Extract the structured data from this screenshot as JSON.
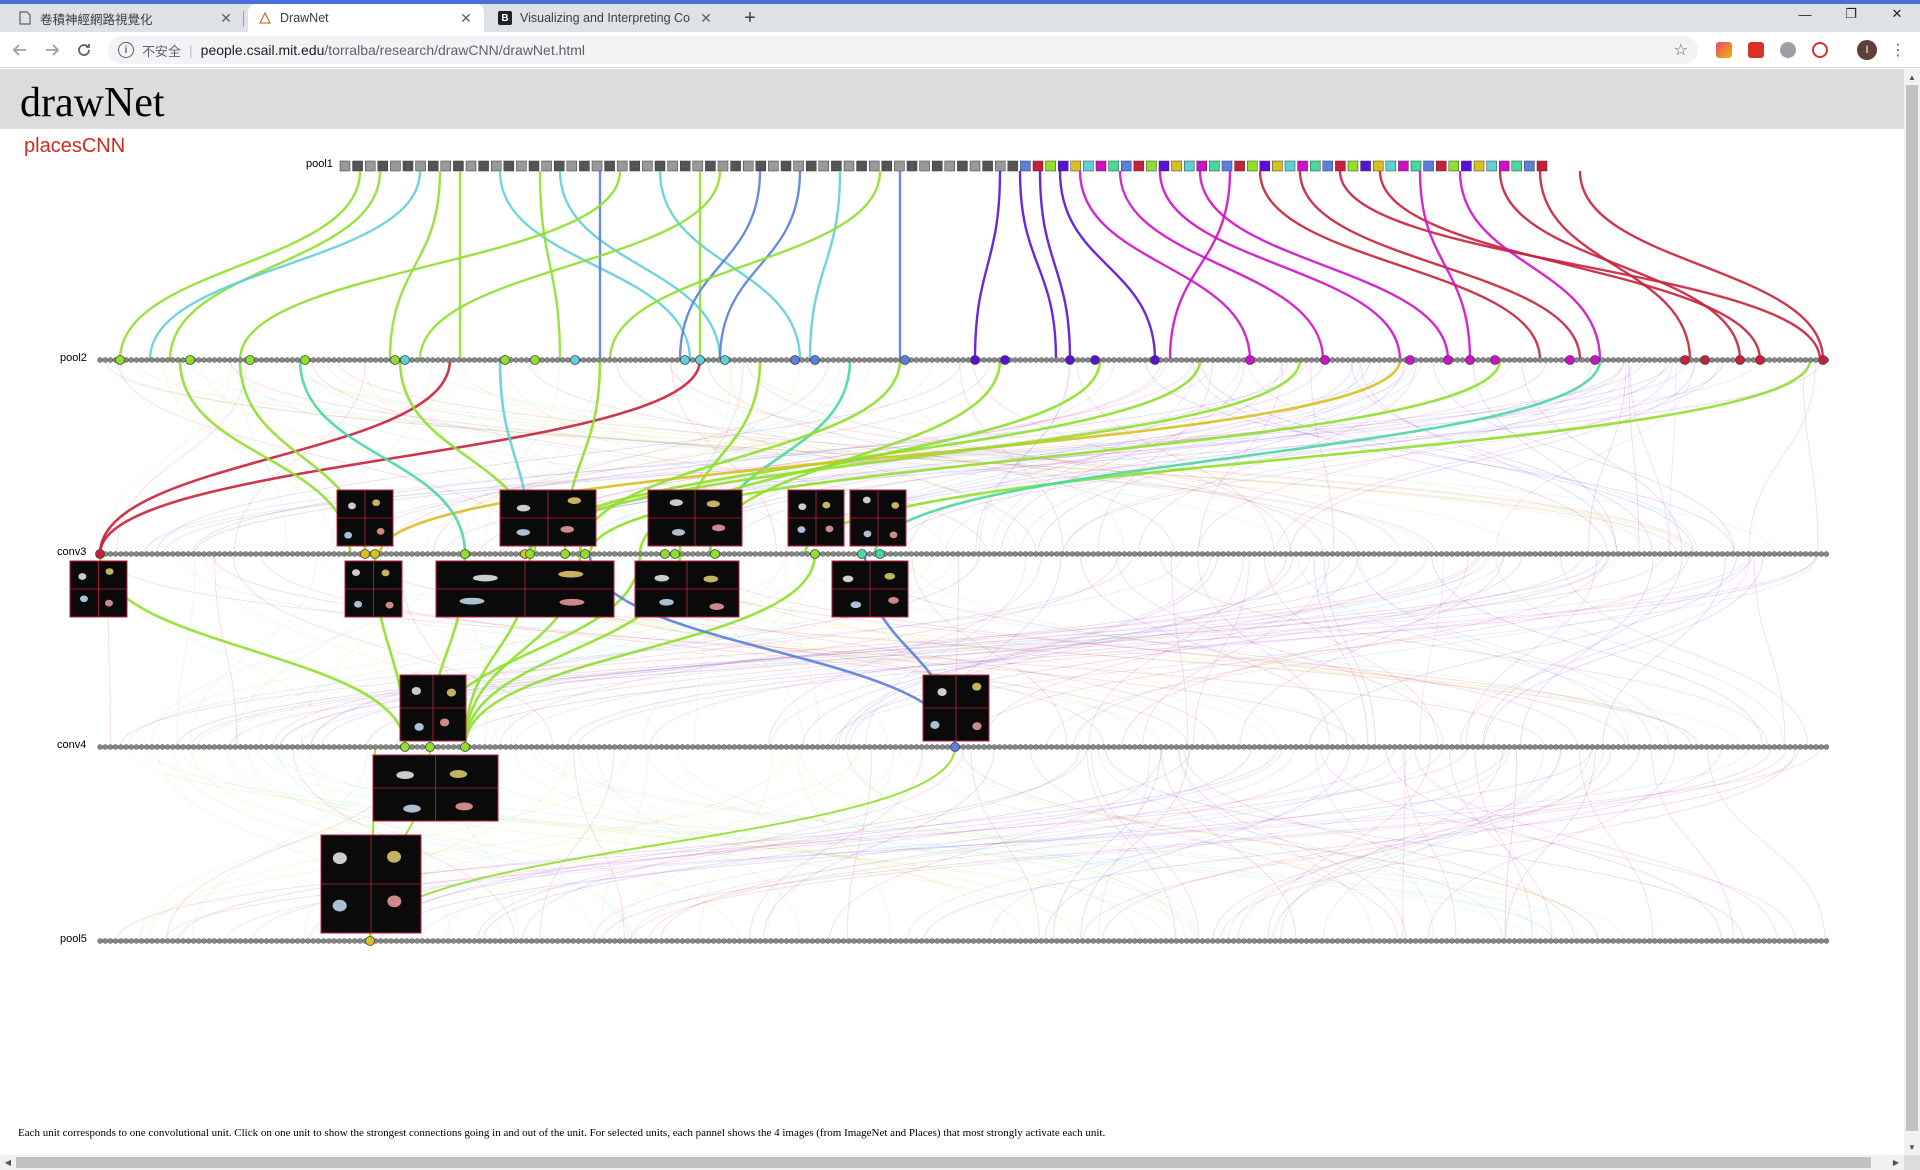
{
  "browser": {
    "tabs": [
      {
        "title": "卷積神經網路視覺化",
        "favicon": "document-icon",
        "active": false
      },
      {
        "title": "DrawNet",
        "favicon": "drawnet-icon",
        "active": true
      },
      {
        "title": "Visualizing and Interpreting Co",
        "favicon": "B",
        "active": false
      }
    ],
    "new_tab": "+",
    "close_glyph": "✕",
    "window_controls": {
      "minimize": "—",
      "restore": "❐",
      "close": "✕"
    },
    "address": {
      "security_label": "不安全",
      "host": "people.csail.mit.edu",
      "path": "/torralba/research/drawCNN/drawNet.html"
    },
    "profile_initial": "I",
    "accent": "#4a6fd8"
  },
  "page": {
    "title": "drawNet",
    "subtitle": "placesCNN",
    "layers": {
      "pool1": "pool1",
      "pool2": "pool2",
      "conv3": "conv3",
      "conv4": "conv4",
      "pool5": "pool5"
    },
    "footnote": "Each unit corresponds to one convolutional unit. Click on one unit to show the strongest connections going in and out of the unit. For selected units, each pannel shows the 4 images (from ImageNet and Places) that most strongly activate each unit.",
    "colors": {
      "green": "#8ee02a",
      "cyan": "#5fcfd8",
      "blue": "#5a7fdc",
      "violet": "#5a10d8",
      "magenta": "#d010c8",
      "crimson": "#c8203a",
      "yellow": "#d8c020",
      "teal": "#48d8a0",
      "unit": "#888888",
      "subtitle": "#d42a1c"
    }
  }
}
